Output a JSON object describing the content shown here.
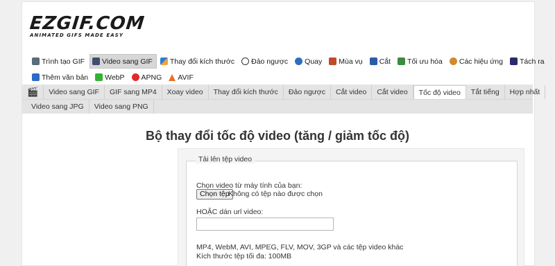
{
  "logo": {
    "main": "EZGIF.COM",
    "tagline": "ANIMATED GIFS MADE EASY"
  },
  "main_nav": {
    "row1": [
      {
        "label": "Trình tạo GIF",
        "icon": "film-icon",
        "active": false
      },
      {
        "label": "Video sang GIF",
        "icon": "video-icon",
        "active": true
      },
      {
        "label": "Thay đổi kích thước",
        "icon": "resize-icon",
        "active": false
      },
      {
        "label": "Đảo ngược",
        "icon": "reverse-icon",
        "active": false
      },
      {
        "label": "Quay",
        "icon": "rotate-icon",
        "active": false
      },
      {
        "label": "Mùa vụ",
        "icon": "crop-icon",
        "active": false
      },
      {
        "label": "Cắt",
        "icon": "cut-icon",
        "active": false
      },
      {
        "label": "Tối ưu hóa",
        "icon": "optimize-icon",
        "active": false
      },
      {
        "label": "Các hiệu ứng",
        "icon": "effects-icon",
        "active": false
      },
      {
        "label": "Tách ra",
        "icon": "split-icon",
        "active": false
      }
    ],
    "row2": [
      {
        "label": "Thêm văn bản",
        "icon": "text-icon",
        "active": false
      },
      {
        "label": "WebP",
        "icon": "webp-icon",
        "active": false
      },
      {
        "label": "APNG",
        "icon": "apng-icon",
        "active": false
      },
      {
        "label": "AVIF",
        "icon": "avif-icon",
        "active": false
      }
    ]
  },
  "sub_nav": {
    "row1": [
      "Video sang GIF",
      "GIF sang MP4",
      "Xoay video",
      "Thay đổi kích thước",
      "Đảo ngược",
      "Cắt video",
      "Cắt video",
      "Tốc độ video",
      "Tắt tiếng",
      "Hợp nhất"
    ],
    "row2": [
      "Video sang JPG",
      "Video sang PNG"
    ],
    "active": "Tốc độ video"
  },
  "page_title": "Bộ thay đổi tốc độ video (tăng / giảm tốc độ)",
  "upload_form": {
    "legend": "Tải lên tệp video",
    "choose_label": "Chọn video từ máy tính của bạn:",
    "file_button": "Chọn tệp",
    "file_status": "Không có tệp nào được chọn",
    "url_label": "HOẶC dán url video:",
    "url_value": "",
    "formats_text": "MP4, WebM, AVI, MPEG, FLV, MOV, 3GP và các tệp video khác",
    "max_size_text": "Kích thước tệp tối đa: 100MB"
  },
  "colors": {
    "upload_button": "#2b63b5",
    "subnav_bg": "#e4e4e4",
    "page_bg": "#f0f0f0"
  }
}
